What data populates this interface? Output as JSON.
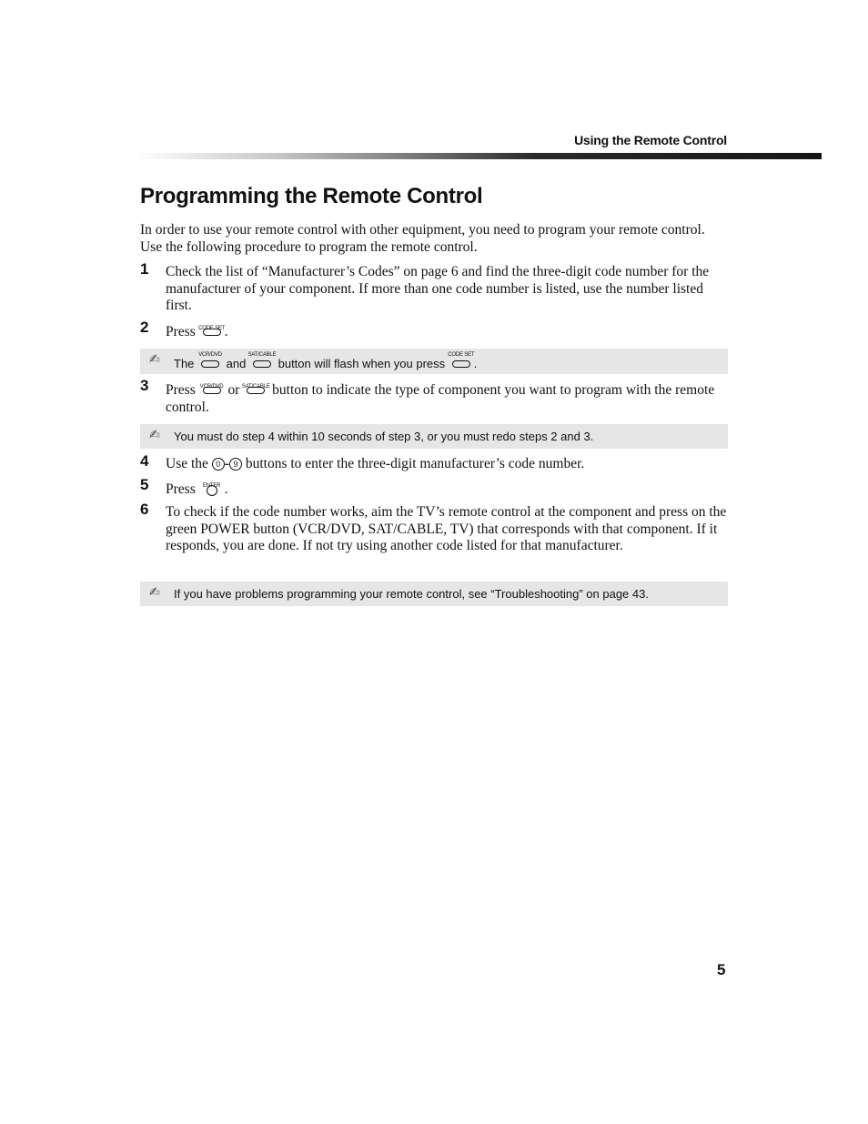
{
  "header": {
    "running_head": "Using the Remote Control"
  },
  "title": "Programming the Remote Control",
  "intro": "In order to use your remote control with other equipment, you need to program your remote control.  Use the following procedure to program the remote control.",
  "buttons": {
    "code_set": "CODE SET",
    "vcr_dvd": "VCR/DVD",
    "sat_cable": "SAT/CABLE",
    "enter": "ENTER",
    "digit_first": "0",
    "digit_last": "9",
    "range_sep": "-"
  },
  "steps": [
    {
      "number": "1",
      "text": "Check the list of “Manufacturer’s Codes” on page 6 and find the three-digit code number for the manufacturer of your component. If more than one code number is listed, use the number listed first."
    },
    {
      "number": "2",
      "text_before": "Press",
      "text_after": "."
    },
    {
      "number": "3",
      "text_before": "Press",
      "text_mid": "or",
      "text_after": "button to indicate the type of component you want to program with the remote control."
    },
    {
      "number": "4",
      "text_before": "Use the",
      "text_after": "buttons to enter the three-digit manufacturer’s code number."
    },
    {
      "number": "5",
      "text_before": "Press",
      "text_after": "."
    },
    {
      "number": "6",
      "text": "To check if the code number works, aim the TV’s remote control at the component and press on the green POWER button (VCR/DVD, SAT/CABLE, TV) that corresponds with that component. If it responds, you are done. If not try using another code listed for that manufacturer."
    }
  ],
  "notes": [
    {
      "icon": "note-pencil-icon",
      "text_before": "The",
      "text_mid": "and",
      "text_after": "button will flash when you press",
      "text_end": "."
    },
    {
      "icon": "note-pencil-icon",
      "text": "You must do step 4 within 10 seconds of step 3, or you must redo steps 2 and 3."
    },
    {
      "icon": "note-pencil-icon",
      "text": "If you have problems programming your remote control, see “Troubleshooting” on page 43."
    }
  ],
  "footer": {
    "page_number": "5"
  }
}
